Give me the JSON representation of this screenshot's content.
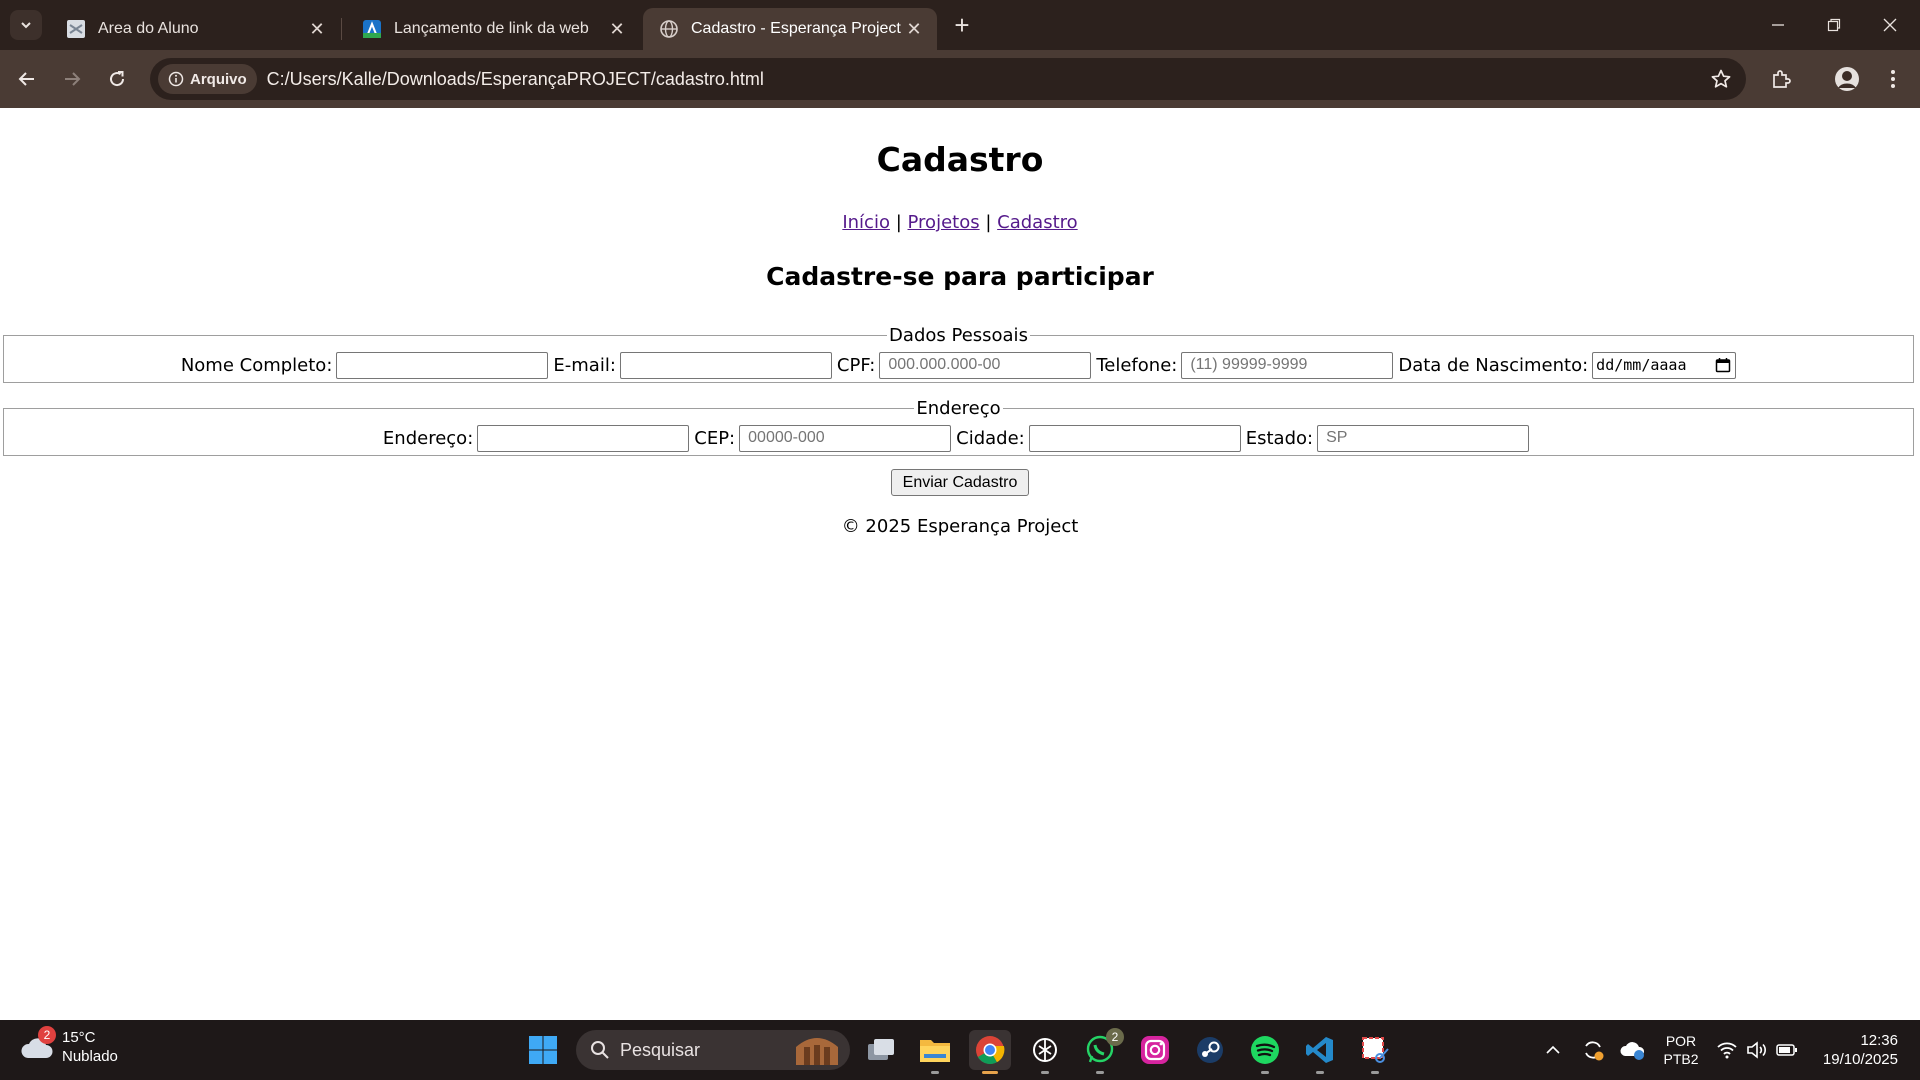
{
  "browser": {
    "tabs": [
      {
        "title": "Area do Aluno",
        "icon": "area-aluno-favicon",
        "active": false
      },
      {
        "title": "Lançamento de link da web",
        "icon": "link-launch-favicon",
        "active": false
      },
      {
        "title": "Cadastro - Esperança Project",
        "icon": "globe-icon",
        "active": true
      }
    ],
    "site_chip": "Arquivo",
    "url": "C:/Users/Kalle/Downloads/EsperançaPROJECT/cadastro.html"
  },
  "page": {
    "title": "Cadastro",
    "nav": {
      "inicio": "Início",
      "projetos": "Projetos",
      "cadastro": "Cadastro",
      "separator": "|"
    },
    "subtitle": "Cadastre-se para participar",
    "personal": {
      "legend": "Dados Pessoais",
      "nome_label": "Nome Completo:",
      "email_label": "E-mail:",
      "cpf_label": "CPF:",
      "cpf_placeholder": "000.000.000-00",
      "telefone_label": "Telefone:",
      "telefone_placeholder": "(11) 99999-9999",
      "nascimento_label": "Data de Nascimento:",
      "nascimento_value": "dd/mm/aaaa"
    },
    "address": {
      "legend": "Endereço",
      "endereco_label": "Endereço:",
      "cep_label": "CEP:",
      "cep_placeholder": "00000-000",
      "cidade_label": "Cidade:",
      "estado_label": "Estado:",
      "estado_placeholder": "SP"
    },
    "submit_label": "Enviar Cadastro",
    "footer": "© 2025 Esperança Project"
  },
  "taskbar": {
    "weather_temp": "15°C",
    "weather_desc": "Nublado",
    "weather_badge": "2",
    "search_placeholder": "Pesquisar",
    "whatsapp_badge": "2",
    "lang_top": "POR",
    "lang_bottom": "PTB2",
    "time": "12:36",
    "date": "19/10/2025"
  }
}
